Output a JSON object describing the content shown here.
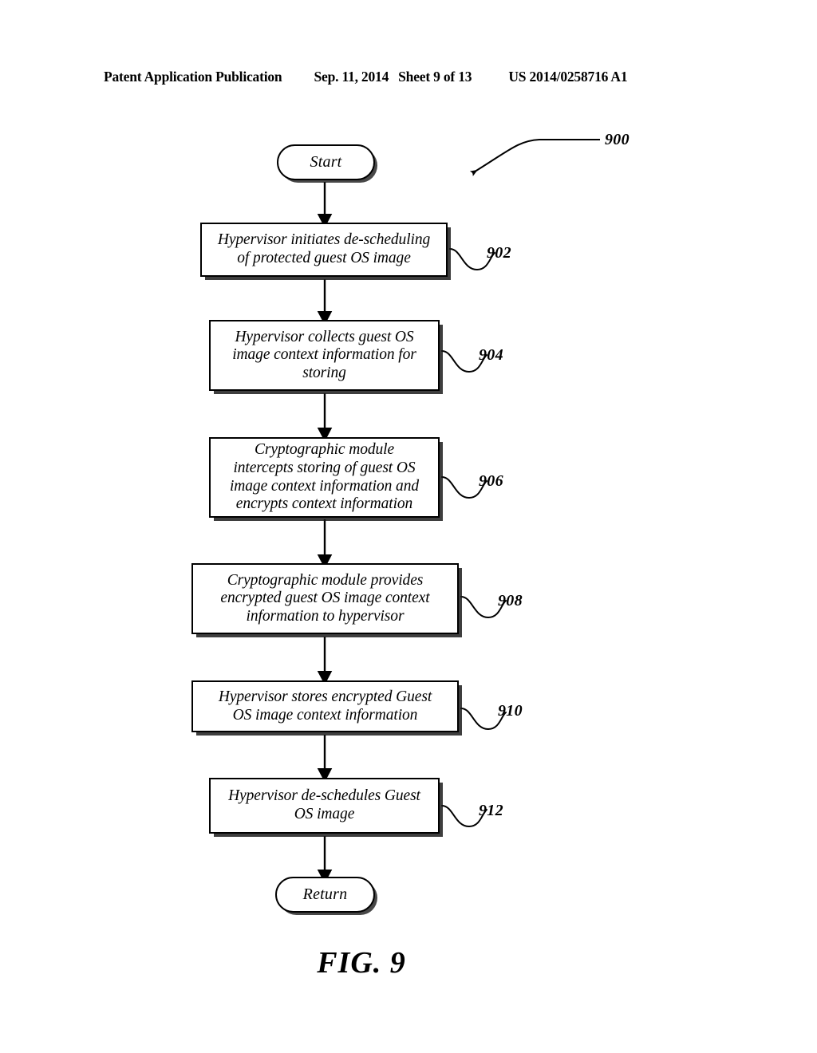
{
  "header": {
    "publication": "Patent Application Publication",
    "date": "Sep. 11, 2014",
    "sheet": "Sheet 9 of 13",
    "patent_number": "US 2014/0258716 A1"
  },
  "figure": {
    "caption": "FIG. 9",
    "diagram_ref": "900",
    "start_label": "Start",
    "return_label": "Return",
    "steps": [
      {
        "ref": "902",
        "text": "Hypervisor initiates de-scheduling\nof protected guest OS image"
      },
      {
        "ref": "904",
        "text": "Hypervisor collects guest OS\nimage context information for\nstoring"
      },
      {
        "ref": "906",
        "text": "Cryptographic module\nintercepts storing of guest OS\nimage context information and\nencrypts context information"
      },
      {
        "ref": "908",
        "text": "Cryptographic module provides\nencrypted guest OS image context\ninformation to hypervisor"
      },
      {
        "ref": "910",
        "text": "Hypervisor stores encrypted Guest\nOS image context information"
      },
      {
        "ref": "912",
        "text": "Hypervisor de-schedules Guest\nOS image"
      }
    ]
  },
  "colors": {
    "ink": "#000000",
    "paper": "#ffffff"
  }
}
